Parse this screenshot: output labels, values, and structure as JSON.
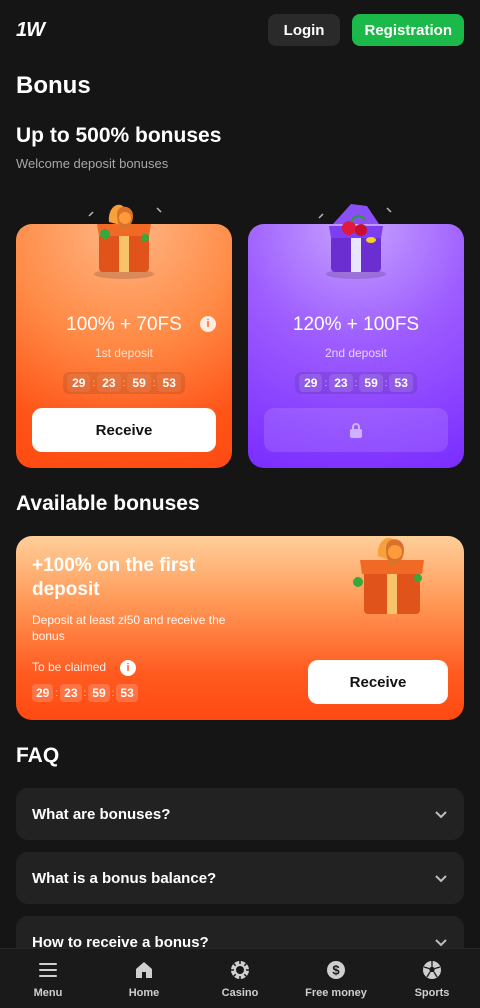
{
  "header": {
    "logo": "1W",
    "login_label": "Login",
    "registration_label": "Registration"
  },
  "page": {
    "title": "Bonus"
  },
  "welcome": {
    "title": "Up to 500% bonuses",
    "subtitle": "Welcome deposit bonuses",
    "cards": [
      {
        "amount": "100% + 70FS",
        "label": "1st deposit",
        "timer": [
          "29",
          "23",
          "59",
          "53"
        ],
        "button_label": "Receive",
        "locked": false
      },
      {
        "amount": "120% + 100FS",
        "label": "2nd deposit",
        "timer": [
          "29",
          "23",
          "59",
          "53"
        ],
        "button_label": "",
        "locked": true
      }
    ]
  },
  "available": {
    "title": "Available bonuses",
    "card": {
      "title": "+100% on the first deposit",
      "description": "Deposit at least zł50 and receive the bonus",
      "claim_label": "To be claimed",
      "timer": [
        "29",
        "23",
        "59",
        "53"
      ],
      "button_label": "Receive"
    }
  },
  "faq": {
    "title": "FAQ",
    "items": [
      {
        "question": "What are bonuses?"
      },
      {
        "question": "What is a bonus balance?"
      },
      {
        "question": "How to receive a bonus?"
      }
    ]
  },
  "bottom_nav": {
    "items": [
      {
        "label": "Menu",
        "icon": "menu-icon"
      },
      {
        "label": "Home",
        "icon": "home-icon"
      },
      {
        "label": "Casino",
        "icon": "casino-chip-icon"
      },
      {
        "label": "Free money",
        "icon": "dollar-icon"
      },
      {
        "label": "Sports",
        "icon": "soccer-ball-icon"
      }
    ]
  },
  "colors": {
    "background": "#151515",
    "register_green": "#1bb84a",
    "orange_card": "#ff5418",
    "purple_card": "#7a2cff"
  }
}
